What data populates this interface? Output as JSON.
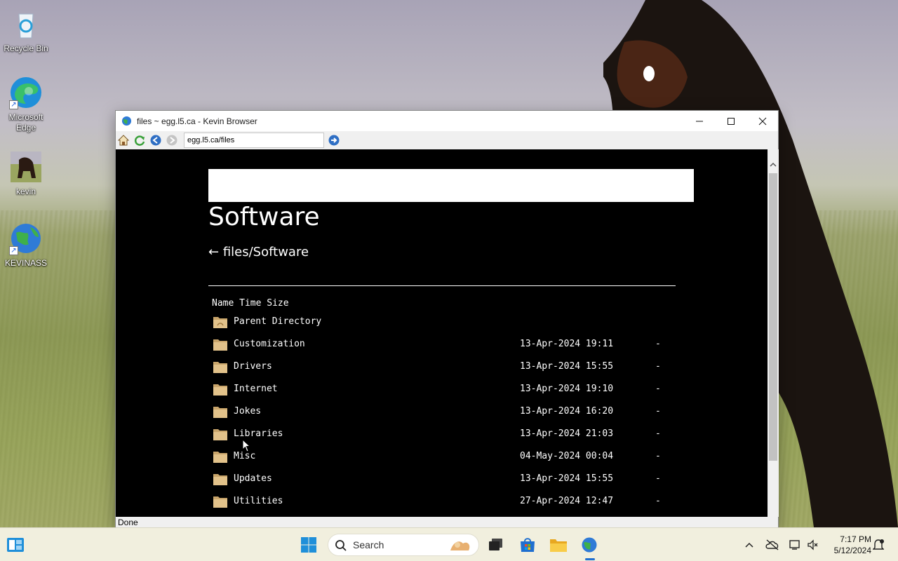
{
  "desktop": {
    "icons": [
      {
        "label": "Recycle Bin"
      },
      {
        "label": "Microsoft Edge"
      },
      {
        "label": "kevin"
      },
      {
        "label": "KEVINASS"
      }
    ]
  },
  "window": {
    "title": "files ~ egg.l5.ca - Kevin Browser",
    "address": "egg.l5.ca/files",
    "status": "Done"
  },
  "page": {
    "title": "Software",
    "breadcrumb_arrow": "←",
    "breadcrumb": "files/Software",
    "table_header": "Name Time Size",
    "parent": "Parent Directory",
    "rows": [
      {
        "name": "Customization",
        "time": "13-Apr-2024 19:11",
        "size": "-"
      },
      {
        "name": "Drivers",
        "time": "13-Apr-2024 15:55",
        "size": "-"
      },
      {
        "name": "Internet",
        "time": "13-Apr-2024 19:10",
        "size": "-"
      },
      {
        "name": "Jokes",
        "time": "13-Apr-2024 16:20",
        "size": "-"
      },
      {
        "name": "Libraries",
        "time": "13-Apr-2024 21:03",
        "size": "-"
      },
      {
        "name": "Misc",
        "time": "04-May-2024 00:04",
        "size": "-"
      },
      {
        "name": "Updates",
        "time": "13-Apr-2024 15:55",
        "size": "-"
      },
      {
        "name": "Utilities",
        "time": "27-Apr-2024 12:47",
        "size": "-"
      }
    ]
  },
  "taskbar": {
    "search_placeholder": "Search",
    "time": "7:17 PM",
    "date": "5/12/2024"
  }
}
